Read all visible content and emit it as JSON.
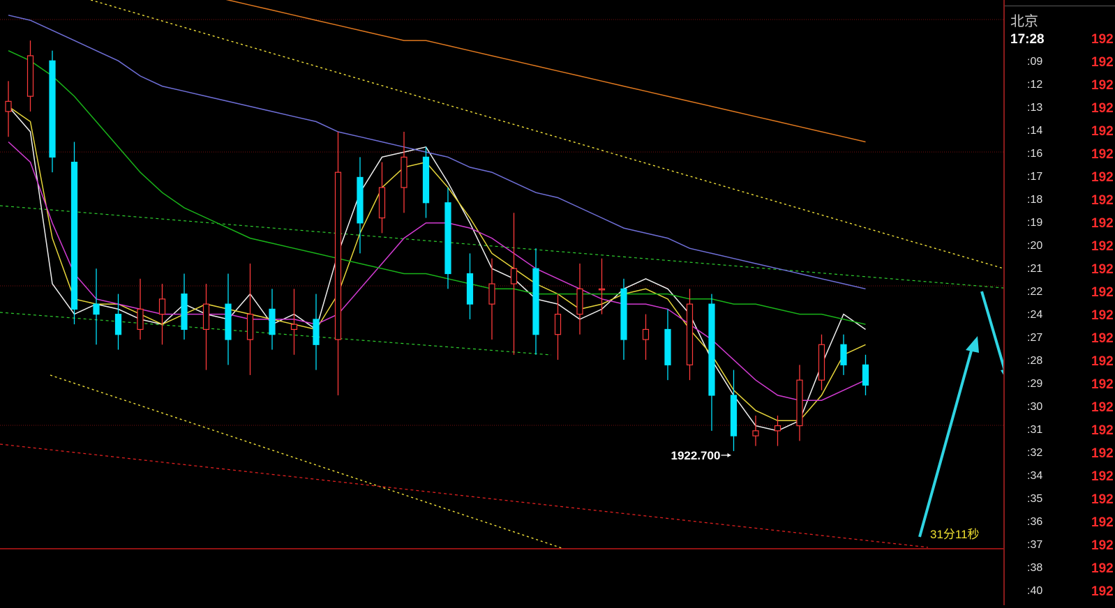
{
  "chart_data": {
    "type": "candlestick",
    "title": "",
    "xlabel": "",
    "ylabel": "",
    "ylim": [
      1920.8,
      1931.6
    ],
    "grid": true,
    "annotations": {
      "low_label": "1922.700",
      "countdown": "31分11秒"
    },
    "colors": {
      "up": "#ff3b3b",
      "down": "#00e5ff",
      "ma_fast": "#f0f0f0",
      "ma_yellow": "#e6d53a",
      "ma_magenta": "#d23bd2",
      "ma_green": "#19b419",
      "ma_blue": "#6f6fd8",
      "ma_orange": "#e0781e",
      "trend_yellow": "#f2e23a",
      "trend_green": "#2fd02f",
      "trend_red": "#e02020",
      "arrow": "#2fd5e3"
    },
    "series": [
      {
        "name": "",
        "color": "#f0f0f0",
        "y": [
          1929.5,
          1929.0,
          1926.0,
          1925.4,
          1925.6,
          1925.5,
          1925.3,
          1925.2,
          1925.6,
          1925.4,
          1925.3,
          1925.8,
          1925.2,
          1925.4,
          1925.1,
          1926.6,
          1927.8,
          1928.5,
          1928.6,
          1928.7,
          1928.0,
          1927.2,
          1926.3,
          1926.1,
          1925.7,
          1925.6,
          1925.3,
          1925.5,
          1925.9,
          1926.1,
          1925.9,
          1925.4,
          1924.5,
          1923.8,
          1923.2,
          1923.1,
          1923.3,
          1924.4,
          1925.4,
          1925.1
        ]
      },
      {
        "name": "",
        "color": "#e6d53a",
        "y": [
          1929.5,
          1929.2,
          1926.9,
          1925.7,
          1925.6,
          1925.6,
          1925.4,
          1925.2,
          1925.4,
          1925.6,
          1925.5,
          1925.4,
          1925.3,
          1925.2,
          1925.1,
          1925.8,
          1927.0,
          1927.9,
          1928.3,
          1928.4,
          1927.9,
          1927.3,
          1926.6,
          1926.3,
          1926.0,
          1925.8,
          1925.5,
          1925.6,
          1925.8,
          1925.9,
          1925.7,
          1925.1,
          1924.6,
          1923.9,
          1923.5,
          1923.3,
          1923.3,
          1923.8,
          1924.6,
          1924.8
        ]
      },
      {
        "name": "",
        "color": "#d23bd2",
        "y": [
          1928.8,
          1928.4,
          1927.2,
          1926.2,
          1925.7,
          1925.6,
          1925.5,
          1925.4,
          1925.4,
          1925.4,
          1925.4,
          1925.3,
          1925.3,
          1925.3,
          1925.2,
          1925.4,
          1925.9,
          1926.4,
          1926.9,
          1927.2,
          1927.2,
          1927.1,
          1926.9,
          1926.6,
          1926.3,
          1926.1,
          1925.9,
          1925.7,
          1925.6,
          1925.6,
          1925.5,
          1925.2,
          1924.9,
          1924.5,
          1924.1,
          1923.8,
          1923.7,
          1923.7,
          1923.9,
          1924.1
        ]
      },
      {
        "name": "",
        "color": "#19b419",
        "y": [
          1930.6,
          1930.4,
          1930.1,
          1929.7,
          1929.2,
          1928.7,
          1928.2,
          1927.8,
          1927.5,
          1927.3,
          1927.1,
          1926.9,
          1926.8,
          1926.7,
          1926.6,
          1926.5,
          1926.4,
          1926.3,
          1926.2,
          1926.2,
          1926.1,
          1926.0,
          1925.9,
          1925.9,
          1925.8,
          1925.8,
          1925.8,
          1925.8,
          1925.8,
          1925.8,
          1925.8,
          1925.7,
          1925.7,
          1925.6,
          1925.6,
          1925.5,
          1925.4,
          1925.4,
          1925.3,
          1925.2
        ]
      },
      {
        "name": "",
        "color": "#6f6fd8",
        "y": [
          1931.3,
          1931.2,
          1931.0,
          1930.8,
          1930.6,
          1930.4,
          1930.1,
          1929.9,
          1929.8,
          1929.7,
          1929.6,
          1929.5,
          1929.4,
          1929.3,
          1929.2,
          1929.0,
          1928.9,
          1928.8,
          1928.7,
          1928.6,
          1928.5,
          1928.3,
          1928.2,
          1928.0,
          1927.8,
          1927.7,
          1927.5,
          1927.3,
          1927.1,
          1927.0,
          1926.9,
          1926.7,
          1926.6,
          1926.5,
          1926.4,
          1926.3,
          1926.2,
          1926.1,
          1926.0,
          1925.9
        ]
      },
      {
        "name": "",
        "color": "#e0781e",
        "y": [
          null,
          null,
          null,
          null,
          null,
          null,
          null,
          null,
          1931.8,
          1931.7,
          1931.6,
          1931.5,
          1931.4,
          1931.3,
          1931.2,
          1931.1,
          1931.0,
          1930.9,
          1930.8,
          1930.8,
          1930.7,
          1930.6,
          1930.5,
          1930.4,
          1930.3,
          1930.2,
          1930.1,
          1930.0,
          1929.9,
          1929.8,
          1929.7,
          1929.6,
          1929.5,
          1929.4,
          1929.3,
          1929.2,
          1929.1,
          1929.0,
          1928.9,
          1928.8
        ]
      }
    ],
    "candles": [
      {
        "o": 1929.4,
        "h": 1930.0,
        "l": 1928.9,
        "c": 1929.6
      },
      {
        "o": 1929.7,
        "h": 1930.8,
        "l": 1929.4,
        "c": 1930.5
      },
      {
        "o": 1930.4,
        "h": 1930.6,
        "l": 1928.2,
        "c": 1928.5
      },
      {
        "o": 1928.4,
        "h": 1928.8,
        "l": 1925.2,
        "c": 1925.5
      },
      {
        "o": 1925.6,
        "h": 1926.3,
        "l": 1924.8,
        "c": 1925.4
      },
      {
        "o": 1925.4,
        "h": 1925.8,
        "l": 1924.7,
        "c": 1925.0
      },
      {
        "o": 1925.1,
        "h": 1926.1,
        "l": 1924.9,
        "c": 1925.5
      },
      {
        "o": 1925.4,
        "h": 1926.0,
        "l": 1924.8,
        "c": 1925.7
      },
      {
        "o": 1925.8,
        "h": 1926.2,
        "l": 1924.9,
        "c": 1925.1
      },
      {
        "o": 1925.1,
        "h": 1926.0,
        "l": 1924.3,
        "c": 1925.6
      },
      {
        "o": 1925.6,
        "h": 1926.2,
        "l": 1924.4,
        "c": 1924.9
      },
      {
        "o": 1924.9,
        "h": 1926.4,
        "l": 1924.2,
        "c": 1925.4
      },
      {
        "o": 1925.5,
        "h": 1925.9,
        "l": 1924.7,
        "c": 1925.0
      },
      {
        "o": 1925.1,
        "h": 1925.9,
        "l": 1924.6,
        "c": 1925.2
      },
      {
        "o": 1925.3,
        "h": 1925.8,
        "l": 1924.3,
        "c": 1924.8
      },
      {
        "o": 1924.9,
        "h": 1929.0,
        "l": 1923.8,
        "c": 1928.2
      },
      {
        "o": 1928.1,
        "h": 1928.5,
        "l": 1926.6,
        "c": 1927.2
      },
      {
        "o": 1927.3,
        "h": 1928.4,
        "l": 1927.0,
        "c": 1927.9
      },
      {
        "o": 1927.9,
        "h": 1929.0,
        "l": 1927.4,
        "c": 1928.5
      },
      {
        "o": 1928.5,
        "h": 1928.7,
        "l": 1927.3,
        "c": 1927.6
      },
      {
        "o": 1927.6,
        "h": 1927.9,
        "l": 1925.9,
        "c": 1926.2
      },
      {
        "o": 1926.2,
        "h": 1926.6,
        "l": 1925.3,
        "c": 1925.6
      },
      {
        "o": 1925.6,
        "h": 1926.5,
        "l": 1924.9,
        "c": 1926.0
      },
      {
        "o": 1926.0,
        "h": 1927.4,
        "l": 1924.6,
        "c": 1926.3
      },
      {
        "o": 1926.3,
        "h": 1926.7,
        "l": 1924.6,
        "c": 1925.0
      },
      {
        "o": 1925.0,
        "h": 1925.8,
        "l": 1924.5,
        "c": 1925.4
      },
      {
        "o": 1925.4,
        "h": 1926.4,
        "l": 1925.0,
        "c": 1925.9
      },
      {
        "o": 1925.9,
        "h": 1926.5,
        "l": 1925.4,
        "c": 1925.9
      },
      {
        "o": 1925.9,
        "h": 1926.1,
        "l": 1924.5,
        "c": 1924.9
      },
      {
        "o": 1924.9,
        "h": 1925.4,
        "l": 1924.5,
        "c": 1925.1
      },
      {
        "o": 1925.1,
        "h": 1925.5,
        "l": 1924.1,
        "c": 1924.4
      },
      {
        "o": 1924.4,
        "h": 1925.9,
        "l": 1924.1,
        "c": 1925.6
      },
      {
        "o": 1925.6,
        "h": 1925.8,
        "l": 1923.1,
        "c": 1923.8
      },
      {
        "o": 1923.8,
        "h": 1924.3,
        "l": 1922.7,
        "c": 1923.0
      },
      {
        "o": 1923.0,
        "h": 1923.4,
        "l": 1922.8,
        "c": 1923.1
      },
      {
        "o": 1923.1,
        "h": 1923.4,
        "l": 1922.8,
        "c": 1923.2
      },
      {
        "o": 1923.2,
        "h": 1924.4,
        "l": 1922.9,
        "c": 1924.1
      },
      {
        "o": 1924.1,
        "h": 1925.0,
        "l": 1923.9,
        "c": 1924.8
      },
      {
        "o": 1924.8,
        "h": 1925.0,
        "l": 1924.2,
        "c": 1924.4
      },
      {
        "o": 1924.4,
        "h": 1924.6,
        "l": 1923.8,
        "c": 1924.0
      }
    ]
  },
  "sidepanel": {
    "city": "北京",
    "current_time": "17:28",
    "current_price": "192",
    "ticks": [
      {
        "time": ":09",
        "price": "192"
      },
      {
        "time": ":12",
        "price": "192"
      },
      {
        "time": ":13",
        "price": "192"
      },
      {
        "time": ":14",
        "price": "192"
      },
      {
        "time": ":16",
        "price": "192"
      },
      {
        "time": ":17",
        "price": "192"
      },
      {
        "time": ":18",
        "price": "192"
      },
      {
        "time": ":19",
        "price": "192"
      },
      {
        "time": ":20",
        "price": "192"
      },
      {
        "time": ":21",
        "price": "192"
      },
      {
        "time": ":22",
        "price": "192"
      },
      {
        "time": ":24",
        "price": "192"
      },
      {
        "time": ":27",
        "price": "192"
      },
      {
        "time": ":28",
        "price": "192"
      },
      {
        "time": ":29",
        "price": "192"
      },
      {
        "time": ":30",
        "price": "192"
      },
      {
        "time": ":31",
        "price": "192"
      },
      {
        "time": ":32",
        "price": "192"
      },
      {
        "time": ":34",
        "price": "192"
      },
      {
        "time": ":35",
        "price": "192"
      },
      {
        "time": ":36",
        "price": "192"
      },
      {
        "time": ":37",
        "price": "192"
      },
      {
        "time": ":38",
        "price": "192"
      },
      {
        "time": ":40",
        "price": "192"
      }
    ]
  }
}
